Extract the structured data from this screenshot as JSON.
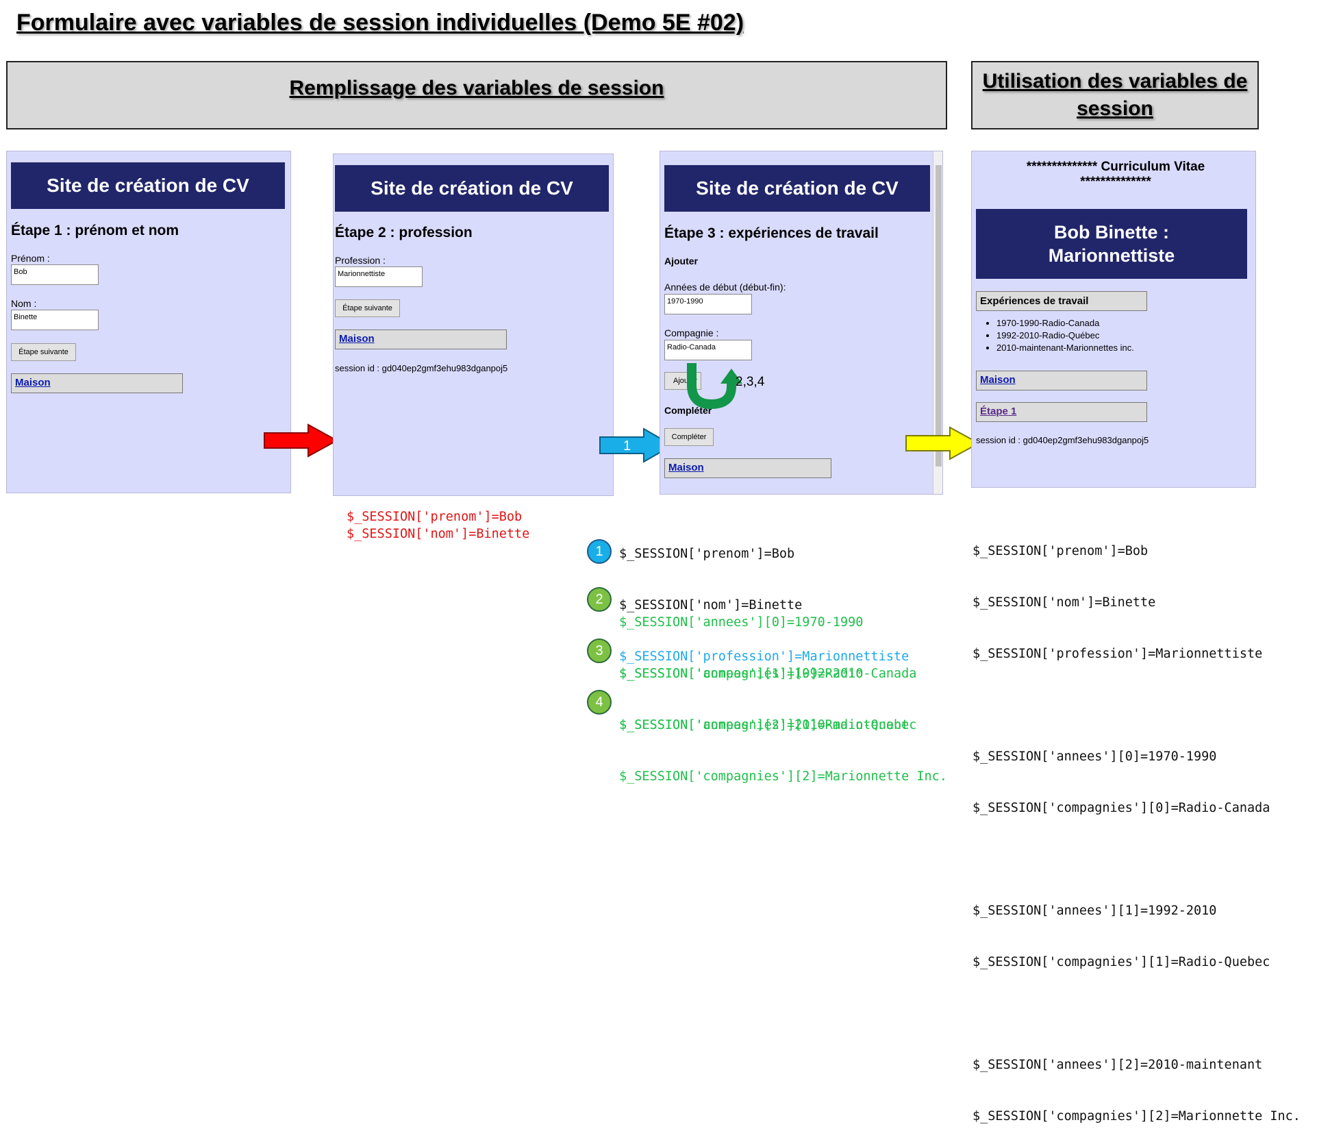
{
  "title": "Formulaire avec variables de session individuelles (Demo 5E #02)",
  "headers": {
    "left": "Remplissage des variables de session",
    "right": "Utilisation des variables de session"
  },
  "site_title": "Site de création de CV",
  "home_link": "Maison",
  "session_id_text": "session id : gd040ep2gmf3ehu983dganpoj5",
  "panel1": {
    "step": "Étape 1 : prénom et nom",
    "firstname_label": "Prénom :",
    "firstname_value": "Bob",
    "lastname_label": "Nom :",
    "lastname_value": "Binette",
    "next_button": "Étape suivante"
  },
  "panel2": {
    "step": "Étape 2 : profession",
    "profession_label": "Profession :",
    "profession_value": "Marionnettiste",
    "next_button": "Étape suivante"
  },
  "panel3": {
    "step": "Étape 3 : expériences de travail",
    "add_heading": "Ajouter",
    "years_label": "Années de début (début-fin):",
    "years_value": "1970-1990",
    "company_label": "Compagnie :",
    "company_value": "Radio-Canada",
    "add_button": "Ajouter",
    "complete_heading": "Compléter",
    "complete_button": "Compléter",
    "loop_label": "2,3,4",
    "arrow_label": "1"
  },
  "panel4": {
    "cv_heading": "************** Curriculum Vitae **************",
    "banner": "Bob Binette : Marionnettiste",
    "experiences_heading": "Expériences de travail",
    "experiences": [
      "1970-1990-Radio-Canada",
      "1992-2010-Radio-Québec",
      "2010-maintenant-Marionnettes inc."
    ],
    "step1_link": "Étape 1"
  },
  "code_red": [
    "$_SESSION['prenom']=Bob",
    "$_SESSION['nom']=Binette"
  ],
  "code_middle": {
    "black": [
      "$_SESSION['prenom']=Bob",
      "$_SESSION['nom']=Binette"
    ],
    "blue": "$_SESSION['profession']=Marionnettiste",
    "groups": [
      {
        "num": "2",
        "lines": [
          "$_SESSION['annees'][0]=1970-1990",
          "$_SESSION['compagnies'][0]=Radio-Canada"
        ]
      },
      {
        "num": "3",
        "lines": [
          "$_SESSION['annees'][1]=1992-2010",
          "$_SESSION['compagnies'][1]=Radio-Quebec"
        ]
      },
      {
        "num": "4",
        "lines": [
          "$_SESSION['annees'][2]=2010-maintenant",
          "$_SESSION['compagnies'][2]=Marionnette Inc."
        ]
      }
    ],
    "blue_num": "1"
  },
  "code_right": [
    "$_SESSION['prenom']=Bob",
    "$_SESSION['nom']=Binette",
    "$_SESSION['profession']=Marionnettiste",
    "$_SESSION['annees'][0]=1970-1990",
    "$_SESSION['compagnies'][0]=Radio-Canada",
    "$_SESSION['annees'][1]=1992-2010",
    "$_SESSION['compagnies'][1]=Radio-Quebec",
    "$_SESSION['annees'][2]=2010-maintenant",
    "$_SESSION['compagnies'][2]=Marionnette Inc."
  ],
  "colors": {
    "banner": "#21266a",
    "panel_bg": "#d9dbfc",
    "red_code": "#e01515",
    "blue_code": "#1ea9e8",
    "green_code": "#1fbf4a",
    "arrow_red": "#ff0000",
    "arrow_blue": "#1aaee8",
    "arrow_yellow": "#ffff00",
    "loop_arrow": "#12964a"
  }
}
